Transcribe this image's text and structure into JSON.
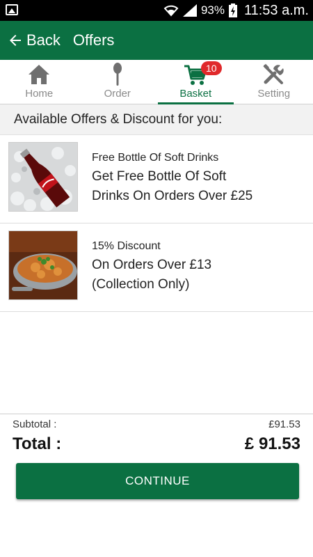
{
  "status_bar": {
    "battery_pct": "93%",
    "time": "11:53 a.m.",
    "icons": [
      "gallery-icon",
      "wifi-icon",
      "signal-icon",
      "battery-icon"
    ]
  },
  "app_bar": {
    "back_label": "Back",
    "title": "Offers",
    "color": "#0b7042"
  },
  "tabs": [
    {
      "label": "Home",
      "icon": "home-icon",
      "active": false
    },
    {
      "label": "Order",
      "icon": "spoon-icon",
      "active": false
    },
    {
      "label": "Basket",
      "icon": "cart-icon",
      "active": true,
      "badge": "10"
    },
    {
      "label": "Setting",
      "icon": "tools-icon",
      "active": false
    }
  ],
  "section_title": "Available Offers & Discount for you:",
  "offers": [
    {
      "name": "Free Bottle Of Soft Drinks",
      "description_line1": "Get Free Bottle Of Soft",
      "description_line2": "Drinks On Orders Over £25",
      "image": "cola-bottle-image"
    },
    {
      "name": "15% Discount",
      "description_line1": "On Orders Over £13",
      "description_line2": "(Collection Only)",
      "image": "curry-dish-image"
    }
  ],
  "totals": {
    "subtotal_label": "Subtotal :",
    "subtotal_value": "£91.53",
    "total_label": "Total :",
    "total_value": "£ 91.53"
  },
  "continue_label": "CONTINUE",
  "colors": {
    "brand_green": "#0b7042",
    "badge_red": "#e0292b"
  }
}
